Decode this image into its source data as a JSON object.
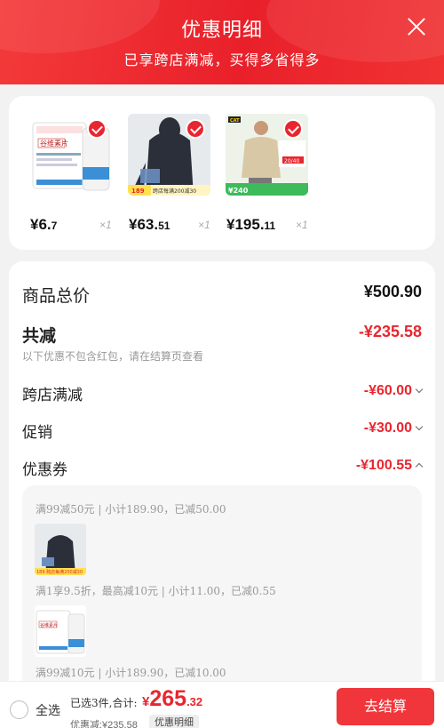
{
  "header": {
    "title": "优惠明细",
    "subtitle": "已享跨店满减，买得多省得多"
  },
  "products": [
    {
      "name": "谷维素片",
      "brand_text": "谷维素片",
      "price_main": "¥6.",
      "price_dec": "7",
      "qty": "×1",
      "checked": true
    },
    {
      "name": "hoodie",
      "price_main": "¥63.",
      "price_dec": "51",
      "qty": "×1",
      "checked": true,
      "tag_price": "189",
      "tag_text": "跨店每满200减30"
    },
    {
      "name": "tshirt",
      "brand_text": "CAT",
      "price_main": "¥195.",
      "price_dec": "11",
      "qty": "×1",
      "checked": true,
      "tag_price": "240",
      "promo_text": "20/40"
    }
  ],
  "summary": {
    "total_label": "商品总价",
    "total_value": "¥500.90",
    "discount_label": "共减",
    "discount_value": "-¥235.58",
    "note": "以下优惠不包含红包，请在结算页查看",
    "rows": [
      {
        "label": "跨店满减",
        "value": "-¥60.00",
        "expanded": false
      },
      {
        "label": "促销",
        "value": "-¥30.00",
        "expanded": false
      },
      {
        "label": "优惠券",
        "value": "-¥100.55",
        "expanded": true
      }
    ]
  },
  "coupons": [
    {
      "text": "满99减50元 | 小计189.90，已减50.00",
      "thumb": "hoodie"
    },
    {
      "text": "满1享9.5折，最高减10元 | 小计11.00，已减0.55",
      "thumb": "pill"
    },
    {
      "text": "满99减10元 | 小计189.90，已减10.00"
    }
  ],
  "bottom": {
    "select_all": "全选",
    "selected_text": "已选3件,合计:",
    "total_yen": "¥",
    "total_int": "265",
    "total_dec": ".32",
    "saved_text": "优惠减:¥235.58",
    "detail_label": "优惠明细",
    "checkout_label": "去结算"
  },
  "colors": {
    "accent": "#e8262f",
    "header": "#f02a30"
  }
}
